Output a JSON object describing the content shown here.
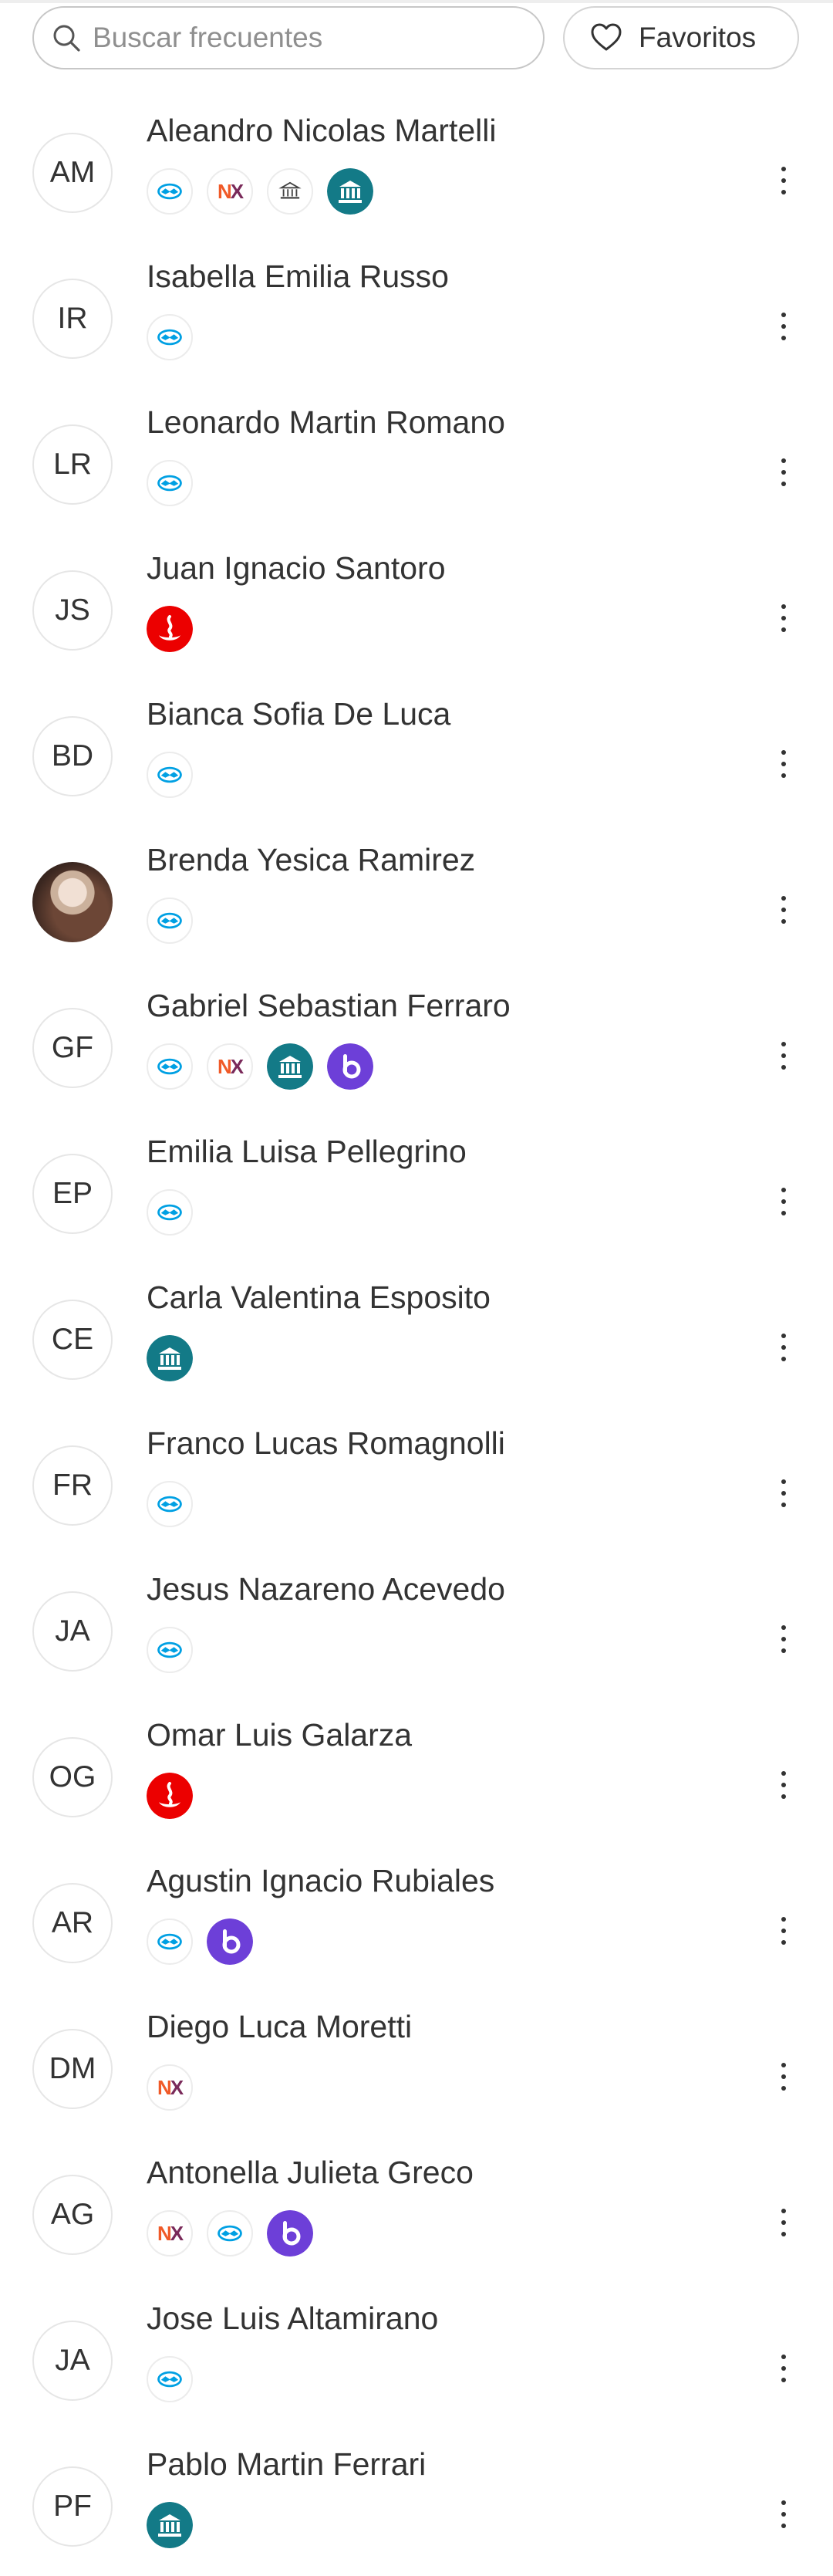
{
  "search": {
    "placeholder": "Buscar frecuentes",
    "value": ""
  },
  "favorites_button": {
    "label": "Favoritos"
  },
  "colors": {
    "text": "#333333",
    "border": "#c7c7c7",
    "mercadopago": "#00a0e3",
    "santander": "#ec0000",
    "bank": "#137a87",
    "brubank": "#6d3fd8"
  },
  "contacts": [
    {
      "initials": "AM",
      "name": "Aleandro Nicolas Martelli",
      "badges": [
        "mercadopago-icon",
        "naranjax-icon",
        "bank-outline-icon",
        "bank-icon"
      ]
    },
    {
      "initials": "IR",
      "name": "Isabella Emilia Russo",
      "badges": [
        "mercadopago-icon"
      ]
    },
    {
      "initials": "LR",
      "name": "Leonardo Martin Romano",
      "badges": [
        "mercadopago-icon"
      ]
    },
    {
      "initials": "JS",
      "name": "Juan Ignacio Santoro",
      "badges": [
        "santander-icon"
      ]
    },
    {
      "initials": "BD",
      "name": "Bianca Sofia De Luca",
      "badges": [
        "mercadopago-icon"
      ]
    },
    {
      "initials": "",
      "photo": true,
      "name": "Brenda Yesica Ramirez",
      "badges": [
        "mercadopago-icon"
      ]
    },
    {
      "initials": "GF",
      "name": "Gabriel Sebastian Ferraro",
      "badges": [
        "mercadopago-icon",
        "naranjax-icon",
        "bank-icon",
        "brubank-icon"
      ]
    },
    {
      "initials": "EP",
      "name": "Emilia Luisa Pellegrino",
      "badges": [
        "mercadopago-icon"
      ]
    },
    {
      "initials": "CE",
      "name": "Carla Valentina Esposito",
      "badges": [
        "bank-icon"
      ]
    },
    {
      "initials": "FR",
      "name": "Franco Lucas Romagnolli",
      "badges": [
        "mercadopago-icon"
      ]
    },
    {
      "initials": "JA",
      "name": "Jesus Nazareno Acevedo",
      "badges": [
        "mercadopago-icon"
      ]
    },
    {
      "initials": "OG",
      "name": "Omar Luis Galarza",
      "badges": [
        "santander-icon"
      ]
    },
    {
      "initials": "AR",
      "name": "Agustin Ignacio Rubiales",
      "badges": [
        "mercadopago-icon",
        "brubank-icon"
      ]
    },
    {
      "initials": "DM",
      "name": "Diego Luca Moretti",
      "badges": [
        "naranjax-icon"
      ]
    },
    {
      "initials": "AG",
      "name": "Antonella Julieta Greco",
      "badges": [
        "naranjax-icon",
        "mercadopago-icon",
        "brubank-icon"
      ]
    },
    {
      "initials": "JA",
      "name": "Jose Luis Altamirano",
      "badges": [
        "mercadopago-icon"
      ]
    },
    {
      "initials": "PF",
      "name": "Pablo Martin Ferrari",
      "badges": [
        "bank-icon"
      ]
    }
  ]
}
